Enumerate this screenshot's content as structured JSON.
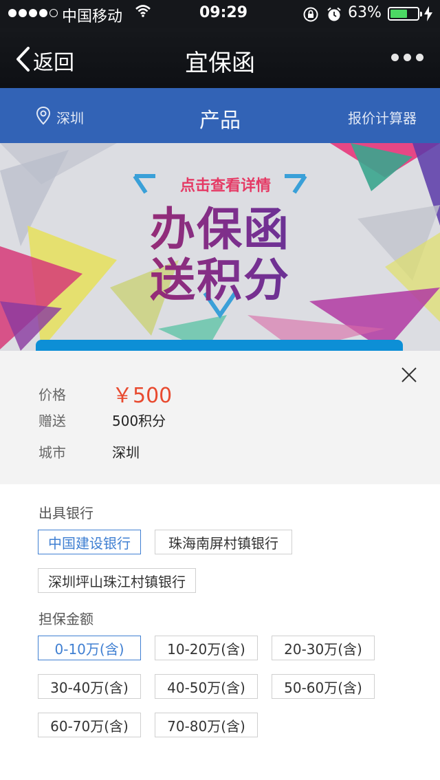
{
  "status_bar": {
    "carrier": "中国移动",
    "time": "09:29",
    "battery": "63%",
    "battery_level": 0.63,
    "signal_bars": 4
  },
  "nav": {
    "back_label": "返回",
    "title": "宜保函"
  },
  "header": {
    "city": "深圳",
    "title": "产品",
    "calculator": "报价计算器"
  },
  "banner": {
    "subtitle": "点击查看详情",
    "line1": "办保函",
    "line2": "送积分"
  },
  "product": {
    "price_label": "价格",
    "price_value": "￥500",
    "gift_label": "赠送",
    "gift_value": "500积分",
    "city_label": "城市",
    "city_value": "深圳"
  },
  "banks": {
    "label": "出具银行",
    "options": [
      "中国建设银行",
      "珠海南屏村镇银行",
      "深圳坪山珠江村镇银行"
    ],
    "selected": 0
  },
  "amounts": {
    "label": "担保金额",
    "options": [
      "0-10万(含)",
      "10-20万(含)",
      "20-30万(含)",
      "30-40万(含)",
      "40-50万(含)",
      "50-60万(含)",
      "60-70万(含)",
      "70-80万(含)"
    ],
    "selected": 0
  },
  "colors": {
    "header_blue": "#3263b6",
    "price_red": "#e84a2f",
    "selected_blue": "#3f7fd2"
  }
}
